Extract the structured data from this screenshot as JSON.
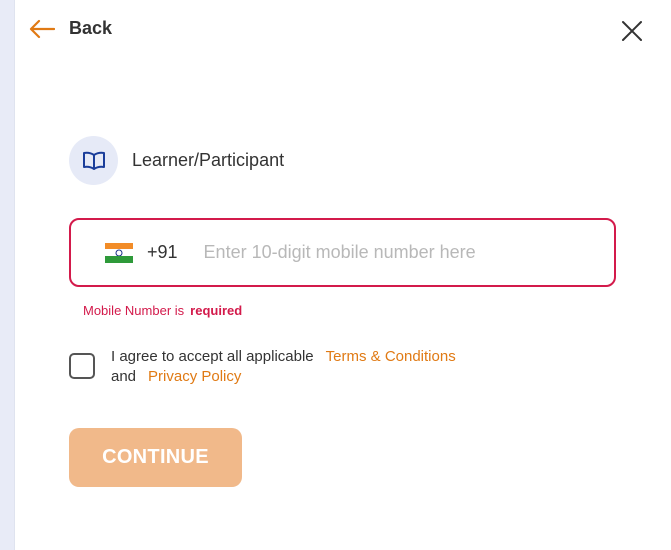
{
  "header": {
    "back_label": "Back",
    "back_icon": "arrow-left-icon",
    "close_icon": "close-icon"
  },
  "role": {
    "icon": "book-open-icon",
    "label": "Learner/Participant"
  },
  "phone": {
    "country_flag": "india-flag-icon",
    "country_code": "+91",
    "value": "",
    "placeholder": "Enter 10-digit mobile number here"
  },
  "error": {
    "prefix": "Mobile Number is",
    "emphasis": "required"
  },
  "agreement": {
    "checked": false,
    "text_before": "I agree to accept all applicable",
    "terms_link": "Terms & Conditions",
    "connector": "and",
    "privacy_link": "Privacy Policy"
  },
  "actions": {
    "continue_label": "CONTINUE"
  },
  "colors": {
    "accent": "#e07a14",
    "error": "#d31a4b",
    "button_disabled": "#f1b98a",
    "icon_blue": "#1a3d9a"
  }
}
